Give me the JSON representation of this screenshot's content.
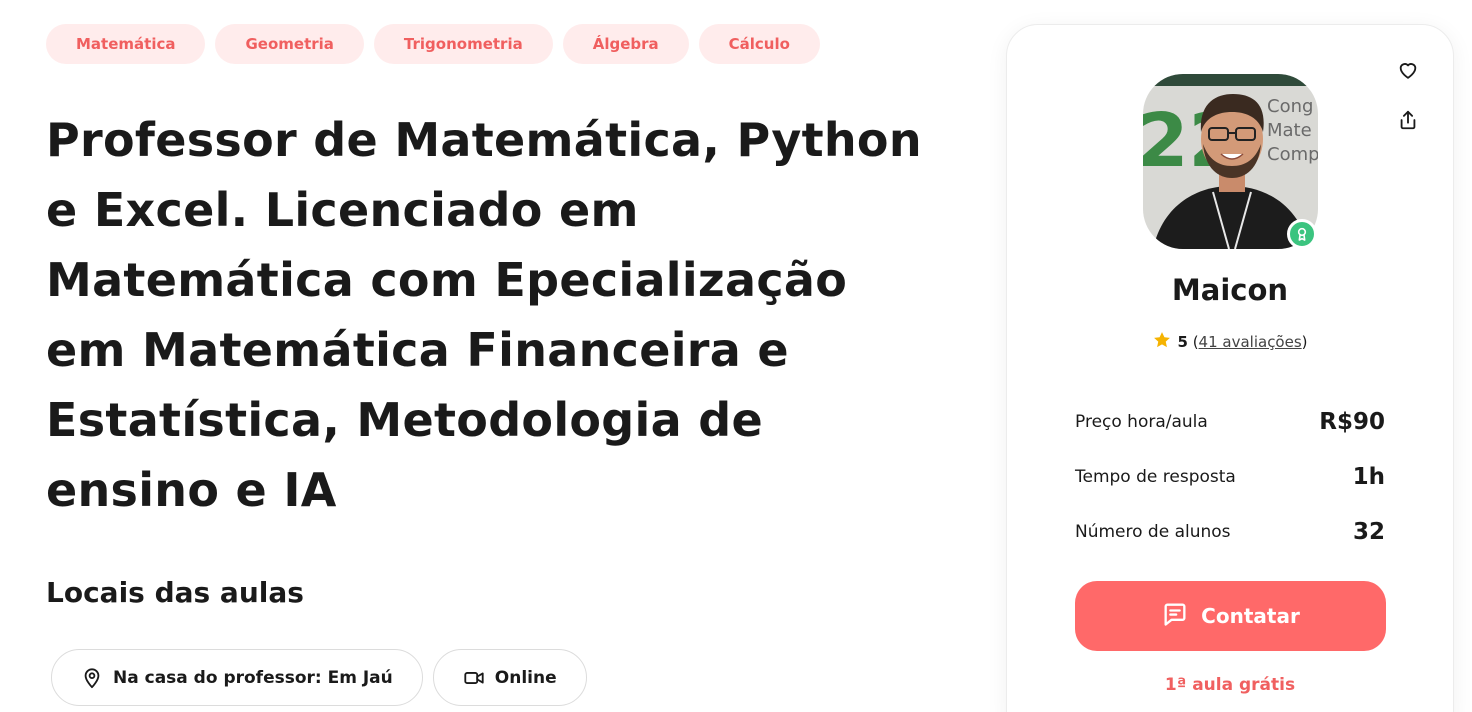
{
  "subject_tags": [
    "Matemática",
    "Geometria",
    "Trigonometria",
    "Álgebra",
    "Cálculo"
  ],
  "title": "Professor de Matemática, Python e Excel. Licenciado em Matemática com Epecialização em Matemática Financeira e Estatística, Metodologia de ensino e IA",
  "locais": {
    "heading": "Locais das aulas",
    "items": [
      {
        "label": "Na casa do professor: Em Jaú",
        "icon": "map-pin-icon"
      },
      {
        "label": "Online",
        "icon": "video-camera-icon"
      }
    ]
  },
  "profile_card": {
    "name": "Maicon",
    "rating": {
      "score": "5",
      "reviews_prefix": "(",
      "reviews_link": "41 avaliações",
      "reviews_suffix": ")"
    },
    "stats": [
      {
        "label": "Preço hora/aula",
        "value": "R$90"
      },
      {
        "label": "Tempo de resposta",
        "value": "1h"
      },
      {
        "label": "Número de alunos",
        "value": "32"
      }
    ],
    "contact_label": "Contatar",
    "free_lesson": "1ª aula grátis",
    "avatar_backdrop_text": {
      "number": "22",
      "lines": [
        "Cong",
        "Mate",
        "Compu"
      ]
    }
  },
  "colors": {
    "accent": "#ff6969",
    "tag_bg": "#ffecec",
    "tag_text": "#f05f5f",
    "badge_green": "#3bc47f",
    "star": "#f5b301"
  }
}
